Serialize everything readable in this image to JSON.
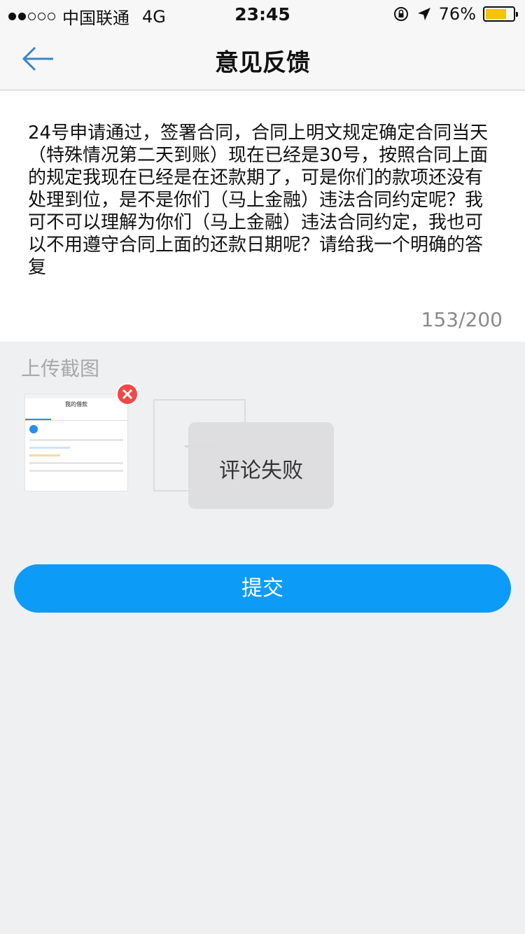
{
  "status_bar": {
    "carrier": "中国联通",
    "network": "4G",
    "time": "23:45",
    "battery": "76%",
    "battery_level": 0.76,
    "battery_color": "#f5c20a"
  },
  "nav": {
    "back_icon": "arrow-left-icon",
    "title": "意见反馈"
  },
  "feedback": {
    "text": "24号申请通过，签署合同，合同上明文规定确定合同当天（特殊情况第二天到账）现在已经是30号，按照合同上面的规定我现在已经是在还款期了，可是你们的款项还没有处理到位，是不是你们（马上金融）违法合同约定呢？我可不可以理解为你们（马上金融）违法合同约定，我也可以不用遵守合同上面的还款日期呢？请给我一个明确的答复",
    "counter": "153/200"
  },
  "upload": {
    "label": "上传截图",
    "thumbnail_title": "我的借款"
  },
  "toast": {
    "message": "评论失败"
  },
  "submit": {
    "label": "提交",
    "color": "#0d9bf8"
  }
}
